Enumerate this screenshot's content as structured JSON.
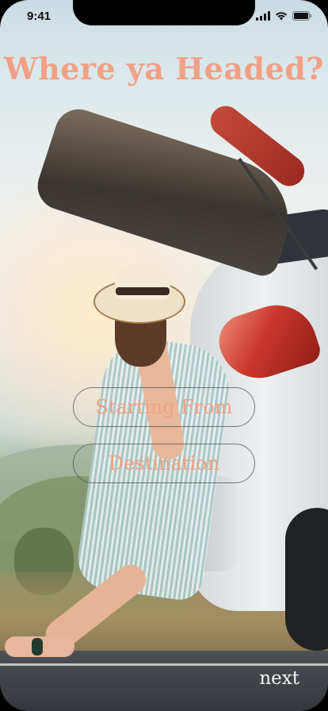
{
  "status_bar": {
    "time": "9:41",
    "icons": [
      "signal-icon",
      "wifi-icon",
      "battery-icon"
    ]
  },
  "screen": {
    "title": "Where ya Headed?",
    "starting_from_label": "Starting From",
    "destination_label": "Destination",
    "next_label": "next"
  },
  "colors": {
    "accent": "#f0a185",
    "next_text": "#f4f4f4"
  }
}
